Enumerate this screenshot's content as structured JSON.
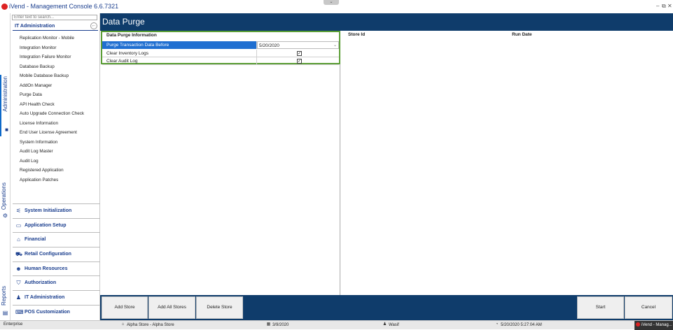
{
  "window": {
    "title": "iVend - Management Console  6.6.7321",
    "minimize_glyph": "–",
    "restore_glyph": "⧉",
    "close_glyph": "✕",
    "grip_glyph": "⌄"
  },
  "side_tabs": [
    {
      "label": "Administration",
      "icon": "admin-icon"
    },
    {
      "label": "Operations",
      "icon": "gear-icon"
    },
    {
      "label": "Reports",
      "icon": "reports-icon"
    }
  ],
  "sidebar": {
    "search_placeholder": "Enter text to search...",
    "section_title": "IT Administration",
    "back_glyph": "←",
    "items": [
      "Replication Monitor - Mobile",
      "Integration Monitor",
      "Integration Failure Monitor",
      "Database Backup",
      "Mobile Database Backup",
      "AddOn Manager",
      "Purge Data",
      "API Health Check",
      "Auto Upgrade Connection Check",
      "License Information",
      "End User License Agreement",
      "System Information",
      "Audit Log Master",
      "Audit Log",
      "Registered Application",
      "Application Patches"
    ],
    "groups": [
      {
        "label": "System Initialization",
        "icon": "sliders-icon",
        "glyph": "⚟"
      },
      {
        "label": "Application Setup",
        "icon": "window-icon",
        "glyph": "▭"
      },
      {
        "label": "Financial",
        "icon": "bank-icon",
        "glyph": "⌂"
      },
      {
        "label": "Retail Configuration",
        "icon": "cart-icon",
        "glyph": "⛟"
      },
      {
        "label": "Human Resources",
        "icon": "people-icon",
        "glyph": "☻"
      },
      {
        "label": "Authorization",
        "icon": "shield-icon",
        "glyph": "⛉"
      },
      {
        "label": "IT Administration",
        "icon": "user-icon",
        "glyph": "♟"
      },
      {
        "label": "POS Customization",
        "icon": "keyboard-icon",
        "glyph": "⌨"
      }
    ]
  },
  "page": {
    "title": "Data Purge",
    "info_header": "Data Purge Information",
    "rows": {
      "purge_before_label": "Purge Transaction Data Before",
      "purge_before_value": "5/20/2020",
      "dropdown_glyph": "⌄",
      "clear_inventory_label": "Clear Inventory Logs",
      "clear_inventory_checked": true,
      "clear_audit_label": "Clear Audit Log",
      "clear_audit_checked": true,
      "check_glyph": "✓"
    },
    "stores_columns": [
      "Store Id",
      "Run Date"
    ]
  },
  "footer": {
    "add_store": "Add Store",
    "add_all_stores": "Add All Stores",
    "delete_store": "Delete Store",
    "start": "Start",
    "cancel": "Cancel"
  },
  "status": {
    "company": "Enterprise",
    "store": "Alpha Store - Alpha Store",
    "date": "3/9/2020",
    "user": "Wasif",
    "datetime": "5/20/2020 5:27:04 AM",
    "taskbar": "iVend - Manag..."
  }
}
